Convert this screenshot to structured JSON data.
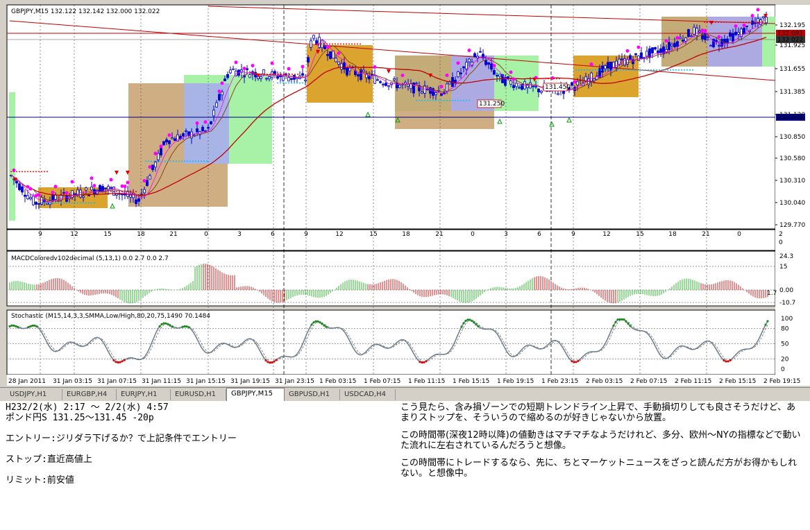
{
  "chart": {
    "header": "GBPJPY,M15  132.122 132.142 132.000 132.022",
    "macd_label": "MACDColoredv102decimal (5,13,1) 0.0 2.7 0.0 2.7",
    "stoch_label": "Stochastic (M15,14,3,3,SMMA,Low/High,80,20,75,1490 70.1484",
    "price_ticks": [
      "132.195",
      "131.925",
      "131.655",
      "131.385",
      "131.120",
      "130.850",
      "130.580",
      "130.310",
      "130.040",
      "129.770"
    ],
    "price_tags": {
      "red": "132.091",
      "dark": "132.022",
      "blue": "131.074"
    },
    "inline_tags": [
      "131.450",
      "131.250"
    ],
    "hour_ticks": [
      "9",
      "12",
      "15",
      "18",
      "21",
      "0",
      "3",
      "6",
      "9",
      "12",
      "15",
      "18",
      "21",
      "0",
      "3",
      "6",
      "9",
      "12",
      "15",
      "18",
      "21",
      "0"
    ],
    "macd_ticks": [
      "24.3",
      "15",
      "0.00",
      "-10.7"
    ],
    "macd_side_value": "1.7",
    "stoch_ticks": [
      "100",
      "80",
      "50",
      "20",
      "0"
    ],
    "top_side_ticks": [
      "2",
      "0"
    ],
    "time_labels": [
      "28 Jan 2011",
      "31 Jan 03:15",
      "31 Jan 07:15",
      "31 Jan 11:15",
      "31 Jan 15:15",
      "31 Jan 19:15",
      "31 Jan 23:15",
      "1 Feb 03:15",
      "1 Feb 07:15",
      "1 Feb 11:15",
      "1 Feb 15:15",
      "1 Feb 19:15",
      "1 Feb 23:15",
      "2 Feb 03:15",
      "2 Feb 07:15",
      "2 Feb 11:15",
      "2 Feb 15:15",
      "2 Feb 19:15"
    ]
  },
  "tabs": [
    {
      "label": "USDJPY,H1",
      "active": false
    },
    {
      "label": "EURGBP,H4",
      "active": false
    },
    {
      "label": "EURJPY,H1",
      "active": false
    },
    {
      "label": "EURUSD,H1",
      "active": false
    },
    {
      "label": "GBPJPY,M15",
      "active": true
    },
    {
      "label": "GBPUSD,H1",
      "active": false
    },
    {
      "label": "USDCAD,H4",
      "active": false
    }
  ],
  "notes": {
    "left": [
      "H232/2(水) 2:17 ～ 2/2(水) 4:57",
      "ポンド円S 131.25～131.45 -20p",
      "",
      "エントリー:ジリダラ下げるか？で上記条件でエントリー",
      "",
      "ストップ:直近高値上",
      "",
      "リミット:前安値"
    ],
    "right": [
      "こう見たら、含み損ゾーンでの短期トレンドライン上昇で、手動損切りしても良さそうだけど、あまりストップを、そういうので縮めるのが好きじゃないから放置。",
      "この時間帯(深夜12時以降)の値動きはマチマチなようだけれど、多分、欧州～NYの指標などで動いた流れに左右されているんだろうと想像。",
      "この時間帯にトレードするなら、先に、ちとマーケットニュースをざっと読んだ方がお得かもしれない。と想像中。"
    ]
  },
  "colors": {
    "box_tan": "#c8a06e",
    "box_green": "#98f098",
    "box_purple": "#a9a9f5",
    "box_orange": "#d4940a",
    "candle_blue": "#0000d0",
    "red_line": "#c00000",
    "macd_green": "#2eb82e",
    "macd_red": "#d02020",
    "stoch_gray": "#708090"
  }
}
